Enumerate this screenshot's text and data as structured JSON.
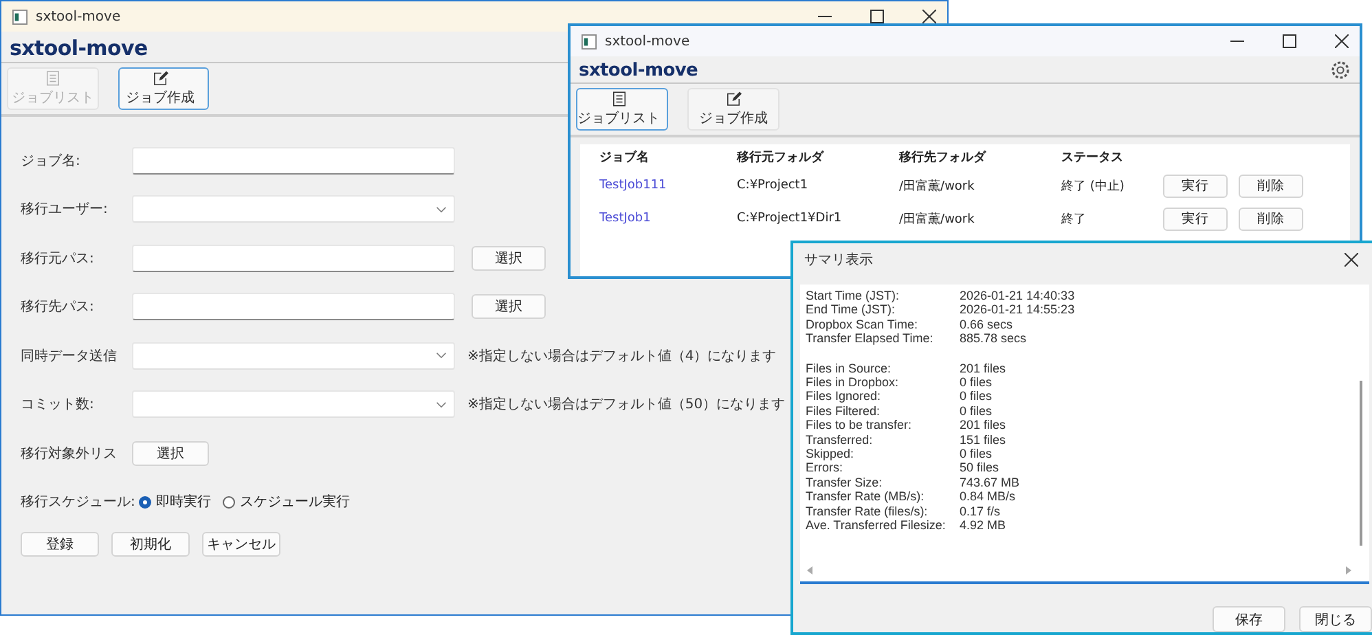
{
  "windows": [
    {
      "title": "sxtool-move",
      "logo": "sxtool-move",
      "tabs": [
        {
          "label": "ジョブリスト",
          "selected": false,
          "disabled": true
        },
        {
          "label": "ジョブ作成",
          "selected": true,
          "disabled": false
        }
      ],
      "form": [
        {
          "kind": "text",
          "label": "ジョブ名:"
        },
        {
          "kind": "select",
          "label": "移行ユーザー:"
        },
        {
          "kind": "path",
          "label": "移行元パス:",
          "button": "選択"
        },
        {
          "kind": "path",
          "label": "移行先パス:",
          "button": "選択"
        },
        {
          "kind": "select",
          "label": "同時データ送信",
          "note": "※指定しない場合はデフォルト値（4）になります"
        },
        {
          "kind": "select",
          "label": "コミット数:",
          "note": "※指定しない場合はデフォルト値（50）になります"
        },
        {
          "kind": "button",
          "label": "移行対象外リス",
          "button": "選択"
        },
        {
          "kind": "radio",
          "label": "移行スケジュール:",
          "options": [
            {
              "label": "即時実行",
              "selected": true
            },
            {
              "label": "スケジュール実行",
              "selected": false
            }
          ]
        }
      ],
      "buttons": [
        "登録",
        "初期化",
        "キャンセル"
      ]
    },
    {
      "title": "sxtool-move",
      "logo": "sxtool-move",
      "settings": true,
      "tabs": [
        {
          "label": "ジョブリスト",
          "selected": true,
          "disabled": false
        },
        {
          "label": "ジョブ作成",
          "selected": false,
          "disabled": false
        }
      ],
      "table": {
        "columns": [
          "ジョブ名",
          "移行元フォルダ",
          "移行先フォルダ",
          "ステータス"
        ],
        "rows": [
          {
            "name": "TestJob111",
            "source": "C:¥Project1",
            "dest": "/田富薫/work",
            "status": "終了 (中止)",
            "actions": [
              "実行",
              "削除"
            ]
          },
          {
            "name": "TestJob1",
            "source": "C:¥Project1¥Dir1",
            "dest": "/田富薫/work",
            "status": "終了",
            "actions": [
              "実行",
              "削除"
            ]
          }
        ]
      }
    }
  ],
  "summary": {
    "title": "サマリ表示",
    "groups": [
      [
        {
          "label": "Start Time (JST):",
          "value": "2026-01-21 14:40:33"
        },
        {
          "label": "End Time (JST):",
          "value": "2026-01-21 14:55:23"
        },
        {
          "label": "Dropbox Scan Time:",
          "value": "0.66 secs"
        },
        {
          "label": "Transfer Elapsed Time:",
          "value": "885.78 secs"
        }
      ],
      [
        {
          "label": "Files in Source:",
          "value": "201 files"
        },
        {
          "label": "Files in Dropbox:",
          "value": "0 files"
        },
        {
          "label": "Files Ignored:",
          "value": "0 files"
        },
        {
          "label": "Files Filtered:",
          "value": "0 files"
        },
        {
          "label": "Files to be transfer:",
          "value": "201 files"
        },
        {
          "label": "Transferred:",
          "value": "151 files"
        },
        {
          "label": "Skipped:",
          "value": "0 files"
        },
        {
          "label": "Errors:",
          "value": "50 files"
        },
        {
          "label": "Transfer Size:",
          "value": "743.67 MB"
        },
        {
          "label": "Transfer Rate (MB/s):",
          "value": "0.84 MB/s"
        },
        {
          "label": "Transfer Rate (files/s):",
          "value": "0.17 f/s"
        },
        {
          "label": "Ave. Transferred Filesize:",
          "value": "4.92 MB"
        }
      ]
    ],
    "buttons": [
      "保存",
      "閉じる"
    ]
  }
}
